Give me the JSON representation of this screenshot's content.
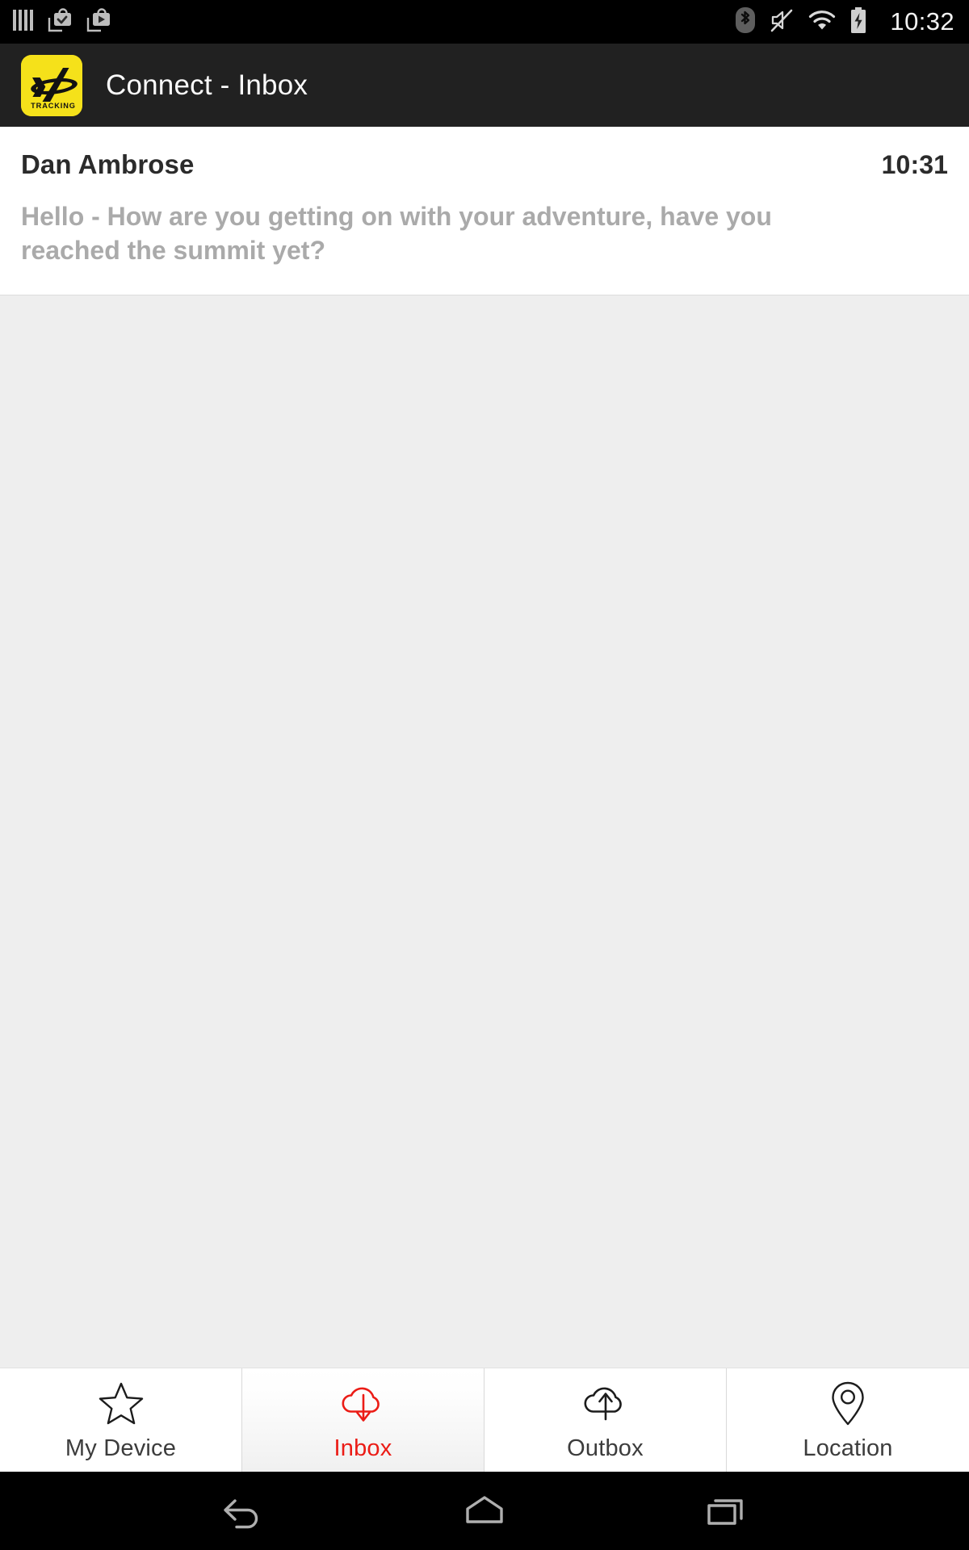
{
  "status_bar": {
    "clock": "10:32",
    "left_icons": [
      "signal-bars-icon",
      "play-store-installed-icon",
      "play-store-download-icon"
    ],
    "right_icons": [
      "bluetooth-icon",
      "volume-muted-icon",
      "wifi-icon",
      "battery-charging-icon"
    ]
  },
  "app_bar": {
    "title": "Connect - Inbox",
    "logo_name": "yb-tracking-logo",
    "logo_bg": "#F5E11A",
    "logo_text": "TRACKING"
  },
  "messages": [
    {
      "sender": "Dan Ambrose",
      "time": "10:31",
      "preview": "Hello - How are you getting on with your adventure, have you reached the summit yet?"
    }
  ],
  "tabs": [
    {
      "label": "My Device",
      "icon": "star-icon",
      "active": false
    },
    {
      "label": "Inbox",
      "icon": "cloud-download-icon",
      "active": true
    },
    {
      "label": "Outbox",
      "icon": "cloud-upload-icon",
      "active": false
    },
    {
      "label": "Location",
      "icon": "map-pin-icon",
      "active": false
    }
  ],
  "nav_bar": {
    "back_label": "back-icon",
    "home_label": "home-icon",
    "recents_label": "recents-icon"
  },
  "colors": {
    "accent_red": "#EB1C16",
    "brand_yellow": "#F5E11A",
    "status_bar_bg": "#000000",
    "app_bar_bg": "#212121",
    "content_bg": "#EEEEEE"
  }
}
